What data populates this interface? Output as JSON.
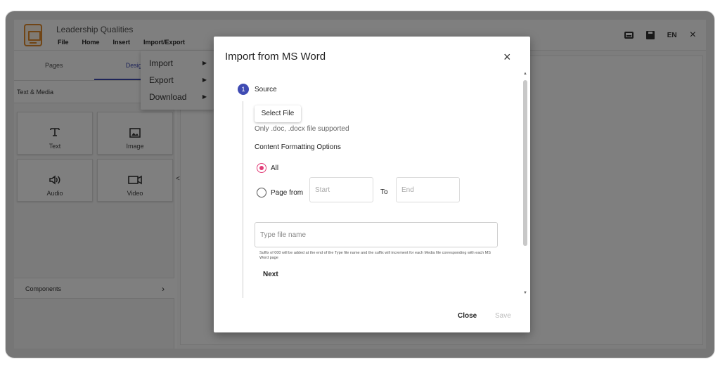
{
  "app": {
    "title": "Leadership Qualities",
    "menu": [
      "File",
      "Home",
      "Insert",
      "Import/Export"
    ],
    "lang": "EN"
  },
  "sidebar": {
    "tabs": [
      "Pages",
      "Desig"
    ],
    "section": "Text & Media",
    "tiles": [
      {
        "label": "Text",
        "icon": "text-icon"
      },
      {
        "label": "Image",
        "icon": "image-icon"
      },
      {
        "label": "Audio",
        "icon": "audio-icon"
      },
      {
        "label": "Video",
        "icon": "video-icon"
      }
    ],
    "components": "Components",
    "collapse_glyph": "<"
  },
  "dropdown": {
    "items": [
      "Import",
      "Export",
      "Download"
    ]
  },
  "modal": {
    "title": "Import from MS Word",
    "step_number": "1",
    "step_label": "Source",
    "select_file": "Select File",
    "supported_hint": "Only .doc, .docx file supported",
    "formatting_heading": "Content Formatting Options",
    "option_all": "All",
    "option_page_from": "Page from",
    "start_placeholder": "Start",
    "to_label": "To",
    "end_placeholder": "End",
    "file_name_placeholder": "Type file name",
    "suffix_note": "Suffix of 000 will be added at the end of the Type file name and the suffix will increment for each Media file corresponding with each MS Word page",
    "next": "Next",
    "close": "Close",
    "save": "Save",
    "selected_option": "All"
  },
  "colors": {
    "accent": "#3f4bb3",
    "radio": "#e23d78",
    "logo": "#e08a2c"
  }
}
